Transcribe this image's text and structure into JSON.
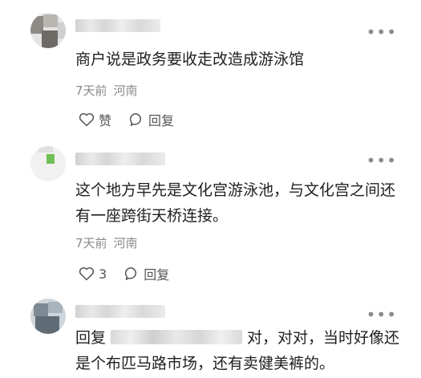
{
  "comments": [
    {
      "text": "商户说是政务要收走改造成游泳馆",
      "time": "7天前",
      "location": "河南",
      "like_label": "赞",
      "reply_label": "回复",
      "like_icon": "heart-outline-icon",
      "reply_icon": "speech-bubble-icon"
    },
    {
      "text": "这个地方早先是文化宫游泳池，与文化宫之间还有一座跨街天桥连接。",
      "time": "7天前",
      "location": "河南",
      "like_label": "3",
      "reply_label": "回复",
      "like_icon": "heart-outline-icon",
      "reply_icon": "speech-bubble-icon"
    },
    {
      "reply_prefix": "回复",
      "text": "对，对对，当时好像还是个布匹马路市场，还有卖健美裤的。"
    }
  ],
  "more_icon": "more-dots-icon",
  "colors": {
    "text": "#1f1f1f",
    "meta": "#8a8a8a",
    "icon": "#555555"
  }
}
